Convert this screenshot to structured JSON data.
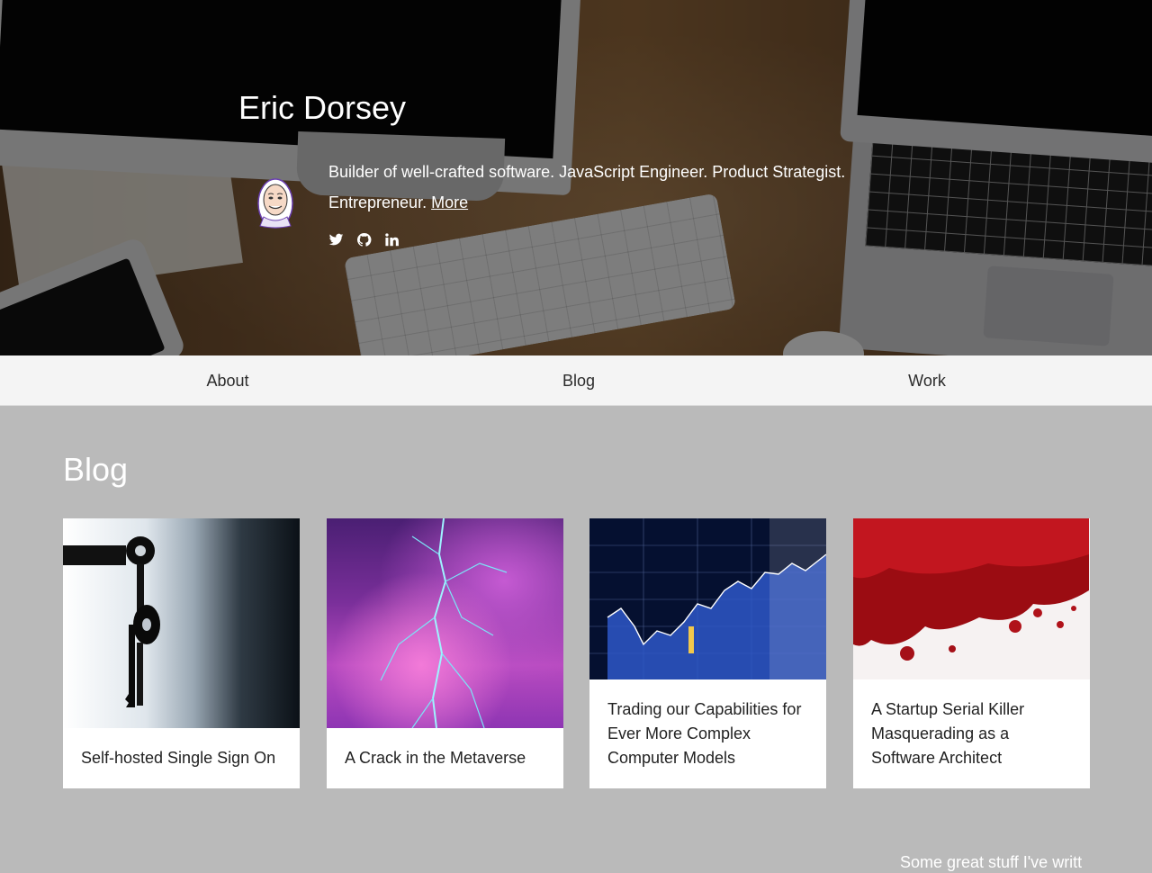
{
  "header": {
    "name": "Eric Dorsey",
    "bio_text": "Builder of well-crafted software. JavaScript Engineer. Product Strategist. Entrepreneur.",
    "more_link": "More",
    "social_icons": [
      "twitter-icon",
      "github-icon",
      "linkedin-icon"
    ]
  },
  "nav": {
    "items": [
      {
        "label": "About"
      },
      {
        "label": "Blog"
      },
      {
        "label": "Work"
      }
    ]
  },
  "blog": {
    "title": "Blog",
    "posts": [
      {
        "title": "Self-hosted Single Sign On",
        "image": "keys-in-door"
      },
      {
        "title": "A Crack in the Metaverse",
        "image": "cracked-purple-sky"
      },
      {
        "title": "Trading our Capabilities for Ever More Complex Computer Models",
        "image": "stock-market-screen"
      },
      {
        "title": "A Startup Serial Killer Masquerading as a Software Architect",
        "image": "blood-splatter"
      }
    ]
  },
  "footer": {
    "partial_text": "Some great stuff I've writt"
  },
  "colors": {
    "page_background": "#bababa",
    "nav_background": "#f4f4f4",
    "card_background": "#ffffff"
  }
}
